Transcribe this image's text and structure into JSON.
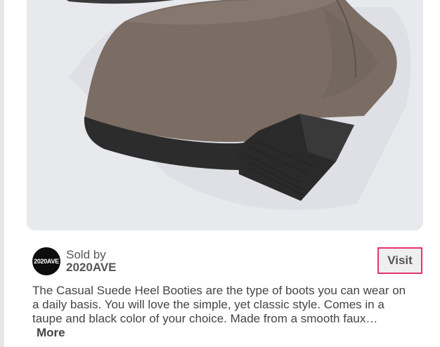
{
  "image": {
    "alt": "",
    "icon": "taupe-suede-heel-bootie",
    "colors": {
      "background": "#e7e8ec",
      "suede": "#7a6c63",
      "sole": "#2b2a2b"
    }
  },
  "seller": {
    "avatar_text": "2020AVE",
    "sold_by_label": "Sold by",
    "name": "2020AVE"
  },
  "visit_label": "Visit",
  "description": {
    "lines": [
      "The Casual Suede Heel Booties are the type of boots you can wear on",
      "a daily basis. You will love the simple, yet classic style. Comes in a",
      "taupe and black color of your choice. Made from a smooth faux…"
    ],
    "more_label": "More"
  },
  "colors": {
    "accent_border": "#e8336d",
    "button_bg": "#efefef",
    "text": "#444444"
  }
}
